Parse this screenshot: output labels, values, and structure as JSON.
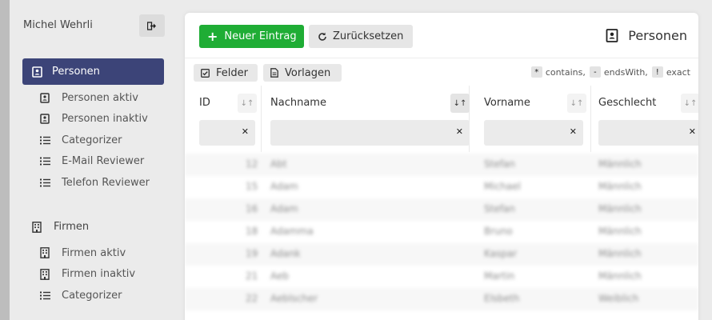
{
  "user": {
    "name": "Michel Wehrli"
  },
  "sidebar": {
    "active": {
      "label": "Personen",
      "icon": "contact-book-icon"
    },
    "persons_sub": [
      {
        "label": "Personen aktiv",
        "icon": "contact-book-icon"
      },
      {
        "label": "Personen inaktiv",
        "icon": "contact-book-icon"
      },
      {
        "label": "Categorizer",
        "icon": "list-icon"
      },
      {
        "label": "E-Mail Reviewer",
        "icon": "list-icon"
      },
      {
        "label": "Telefon Reviewer",
        "icon": "list-icon"
      }
    ],
    "companies": {
      "label": "Firmen",
      "icon": "building-icon"
    },
    "companies_sub": [
      {
        "label": "Firmen aktiv",
        "icon": "building-icon"
      },
      {
        "label": "Firmen inaktiv",
        "icon": "building-icon"
      },
      {
        "label": "Categorizer",
        "icon": "list-icon"
      }
    ]
  },
  "header": {
    "new_button": "Neuer Eintrag",
    "reset_button": "Zurücksetzen",
    "title": "Personen"
  },
  "toolbar": {
    "fields_button": "Felder",
    "templates_button": "Vorlagen",
    "legend": [
      {
        "key": "*",
        "label": "contains,"
      },
      {
        "key": "-",
        "label": "endsWith,"
      },
      {
        "key": "!",
        "label": "exact"
      }
    ]
  },
  "columns": [
    {
      "label": "ID"
    },
    {
      "label": "Nachname"
    },
    {
      "label": "Vorname"
    },
    {
      "label": "Geschlecht"
    }
  ],
  "rows": [
    [
      "12",
      "Abt",
      "Stefan",
      "Männlich"
    ],
    [
      "15",
      "Adam",
      "Michael",
      "Männlich"
    ],
    [
      "16",
      "Adam",
      "Stefan",
      "Männlich"
    ],
    [
      "18",
      "Adamma",
      "Bruno",
      "Männlich"
    ],
    [
      "19",
      "Adank",
      "Kaspar",
      "Männlich"
    ],
    [
      "21",
      "Aeb",
      "Martin",
      "Männlich"
    ],
    [
      "22",
      "Aeblscher",
      "Elsbeth",
      "Weiblich"
    ]
  ],
  "colors": {
    "accent": "#3c4478",
    "success": "#1fad35",
    "background": "#ebebeb"
  }
}
